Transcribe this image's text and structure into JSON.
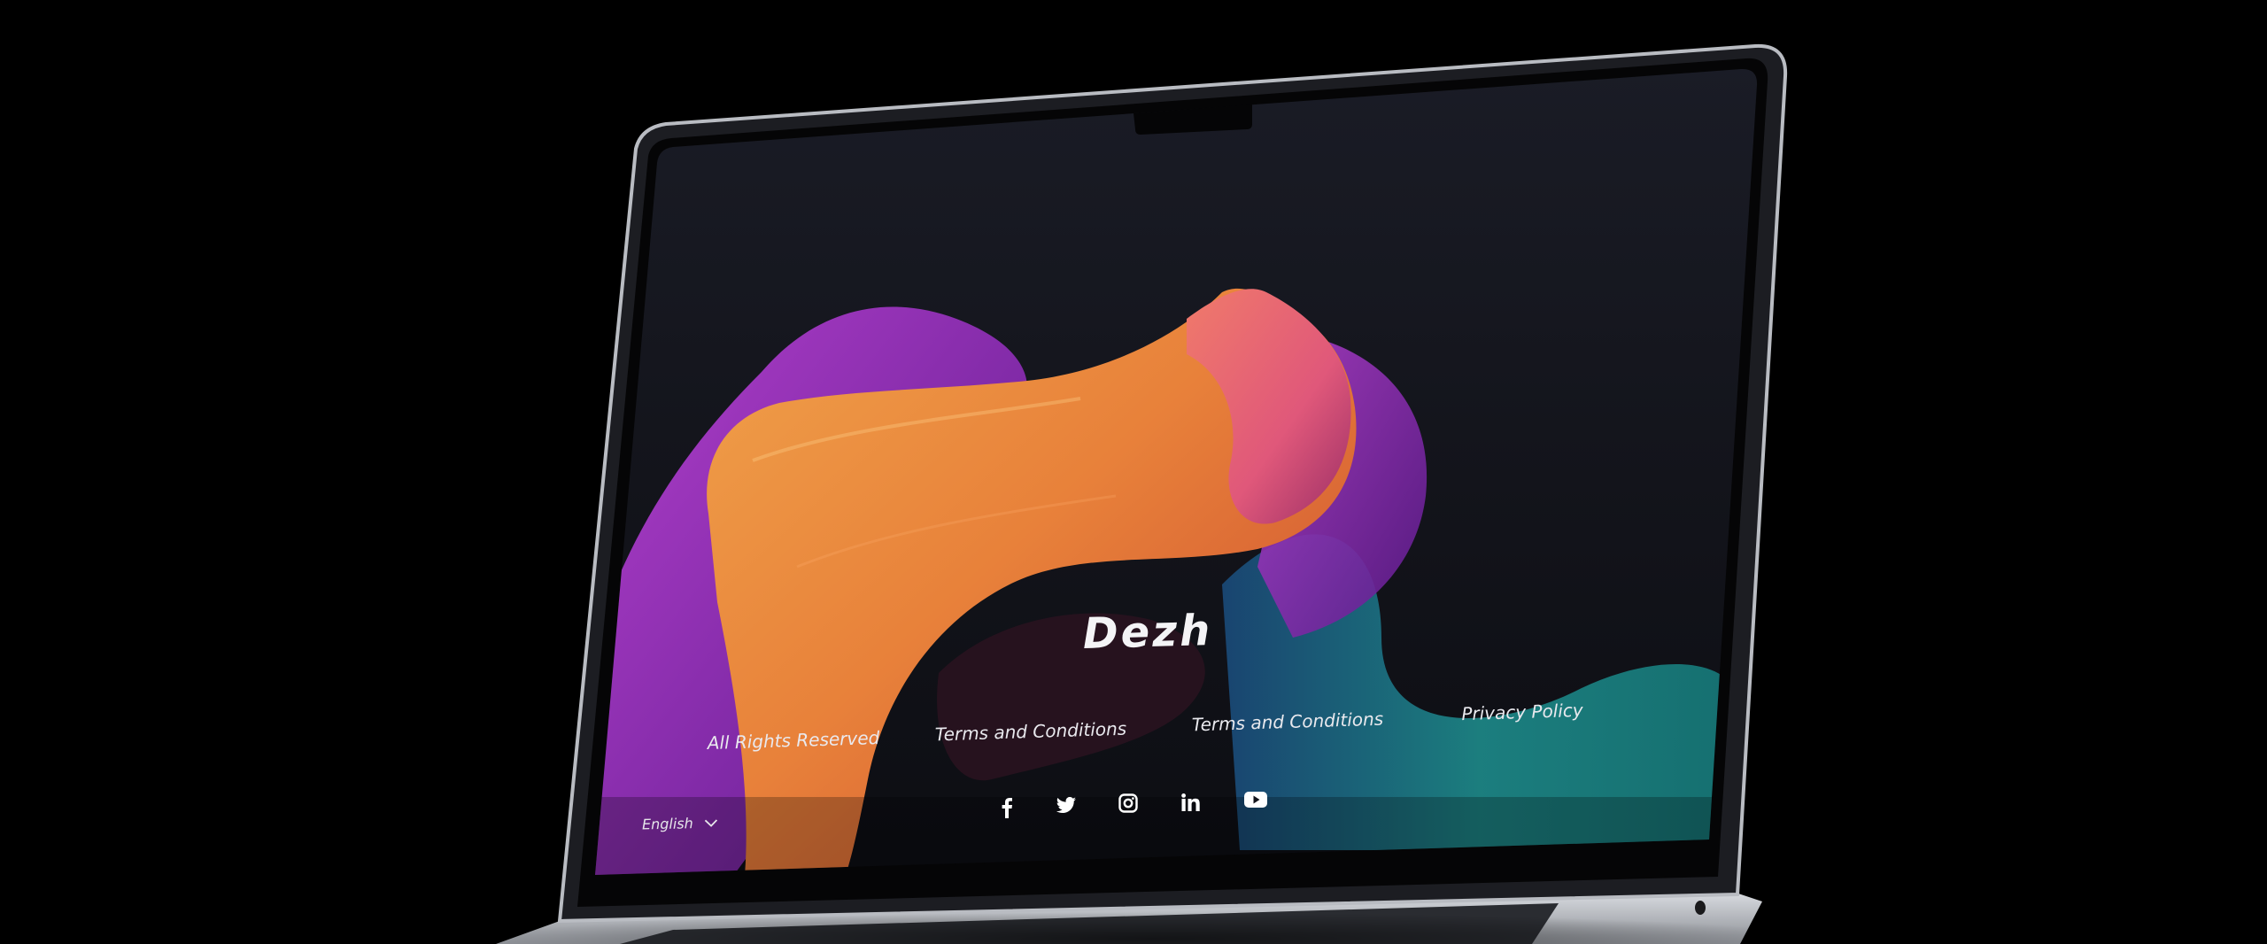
{
  "page": {
    "brand": "Dezh",
    "footer_links": [
      "All Rights Reserved",
      "Terms and Conditions",
      "Terms and Conditions",
      "Privacy Policy"
    ],
    "social_icons": [
      "facebook-icon",
      "twitter-icon",
      "instagram-icon",
      "linkedin-icon",
      "youtube-icon"
    ],
    "language": {
      "selected": "English",
      "icon": "chevron-down-icon"
    }
  },
  "colors": {
    "background": "#000000",
    "screen": "#14151c",
    "text": "#f4f4f6",
    "wave_orange": "#e8813a",
    "wave_pink": "#e0587a",
    "wave_purple": "#8a2bb0",
    "wave_teal": "#1d8a8a"
  }
}
